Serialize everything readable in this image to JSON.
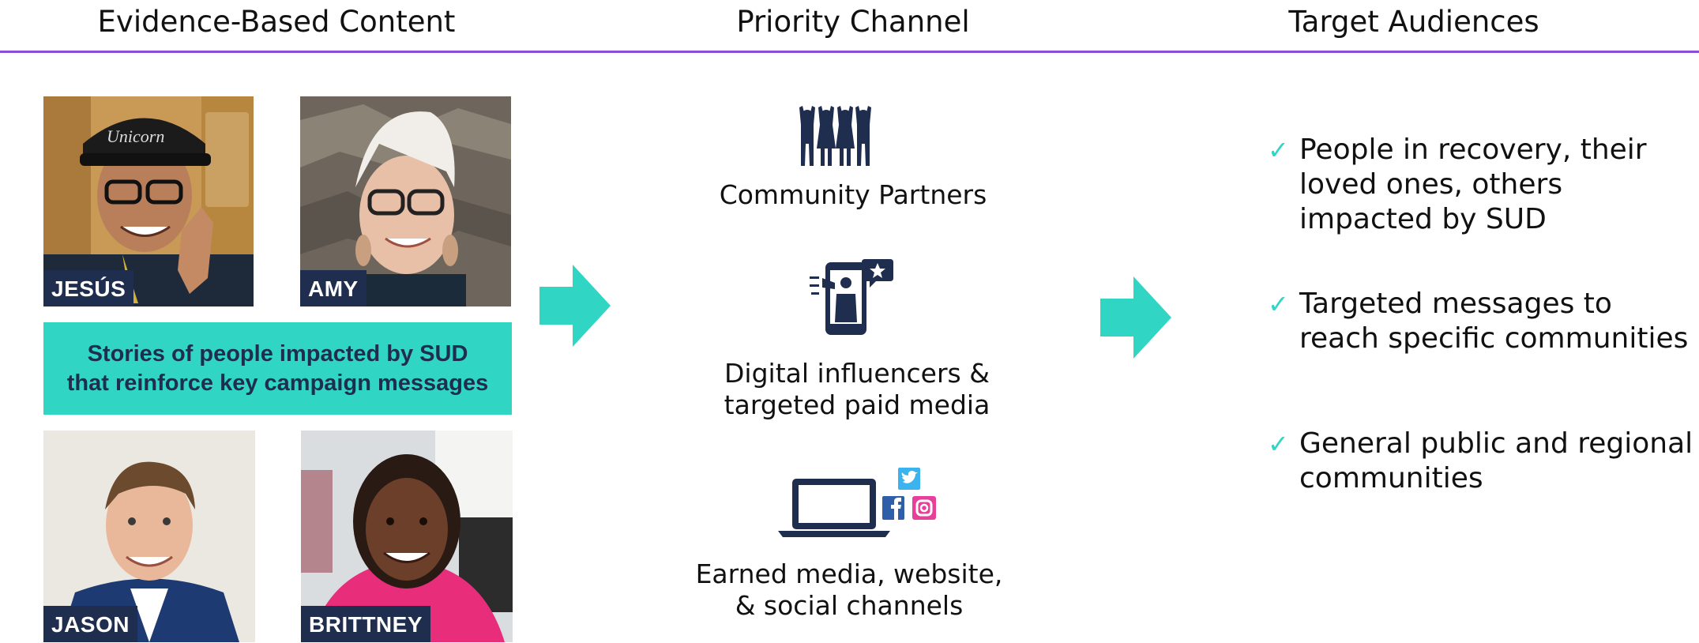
{
  "headers": {
    "evidence": "Evidence-Based Content",
    "channel": "Priority Channel",
    "audiences": "Target Audiences"
  },
  "people": {
    "jesus": "JESÚS",
    "amy": "AMY",
    "jason": "JASON",
    "brittney": "BRITTNEY"
  },
  "stories_text": "Stories of people impacted by SUD\nthat reinforce key campaign messages",
  "channels": [
    {
      "icon": "community-people-icon",
      "label": "Community Partners"
    },
    {
      "icon": "phone-influencer-icon",
      "label": "Digital influencers &\ntargeted paid media"
    },
    {
      "icon": "laptop-social-icon",
      "label": "Earned media, website,\n& social channels"
    }
  ],
  "audiences": [
    "People in recovery, their loved ones, others impacted by SUD",
    "Targeted messages to reach specific communities",
    "General public and regional communities"
  ],
  "colors": {
    "accent_teal": "#30d5c3",
    "navy": "#1f2d4e",
    "rule_purple": "#8a4fd8"
  }
}
